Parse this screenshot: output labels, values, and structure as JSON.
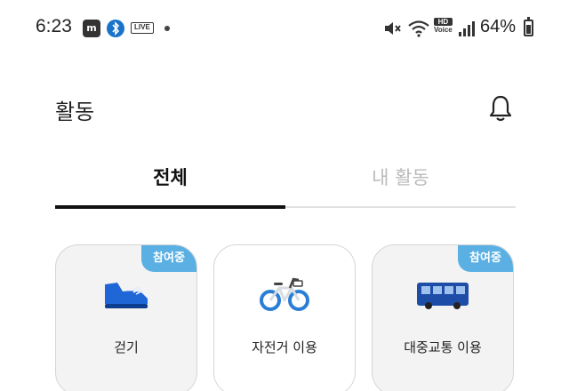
{
  "status_bar": {
    "time": "6:23",
    "live_label": "LIVE",
    "hd_top": "HD",
    "hd_bottom": "Voice",
    "battery": "64%",
    "battery_level": 0.64,
    "icons": [
      "app-notification-icon",
      "bluetooth-app-icon",
      "live-icon",
      "mute-icon",
      "wifi-icon",
      "hd-voice-icon",
      "signal-icon",
      "battery-icon"
    ]
  },
  "header": {
    "title": "활동",
    "bell_icon": "bell-icon"
  },
  "tabs": [
    {
      "label": "전체",
      "active": true
    },
    {
      "label": "내 활동",
      "active": false
    }
  ],
  "cards": [
    {
      "label": "걷기",
      "badge": "참여중",
      "icon": "shoe-icon"
    },
    {
      "label": "자전거 이용",
      "badge": "",
      "icon": "bicycle-icon"
    },
    {
      "label": "대중교통 이용",
      "badge": "참여중",
      "icon": "bus-icon"
    }
  ],
  "colors": {
    "badge": "#5bb0e3",
    "tab_active": "#111111",
    "tab_inactive": "#bbbbbb",
    "shoe": "#1f66d6",
    "bus": "#1e4da8"
  }
}
